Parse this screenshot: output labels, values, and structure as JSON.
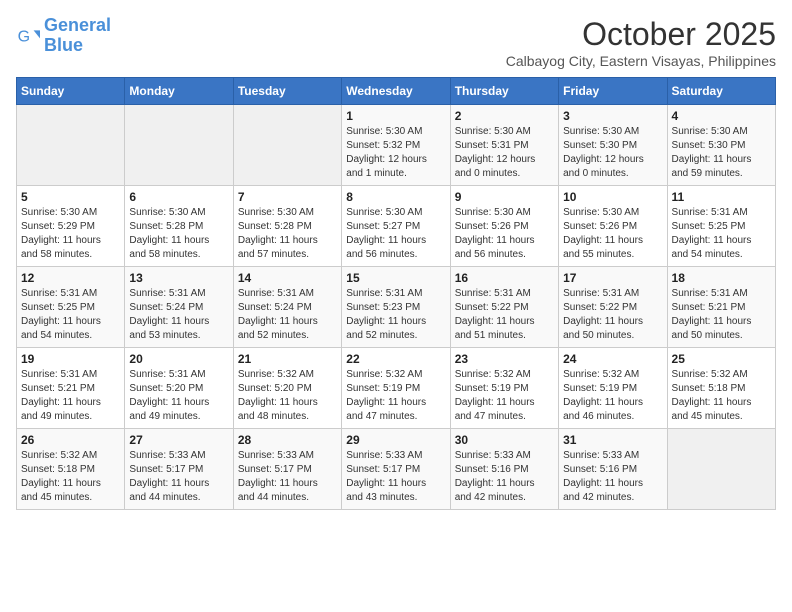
{
  "logo": {
    "line1": "General",
    "line2": "Blue"
  },
  "title": "October 2025",
  "subtitle": "Calbayog City, Eastern Visayas, Philippines",
  "headers": [
    "Sunday",
    "Monday",
    "Tuesday",
    "Wednesday",
    "Thursday",
    "Friday",
    "Saturday"
  ],
  "weeks": [
    [
      {
        "day": "",
        "info": ""
      },
      {
        "day": "",
        "info": ""
      },
      {
        "day": "",
        "info": ""
      },
      {
        "day": "1",
        "info": "Sunrise: 5:30 AM\nSunset: 5:32 PM\nDaylight: 12 hours\nand 1 minute."
      },
      {
        "day": "2",
        "info": "Sunrise: 5:30 AM\nSunset: 5:31 PM\nDaylight: 12 hours\nand 0 minutes."
      },
      {
        "day": "3",
        "info": "Sunrise: 5:30 AM\nSunset: 5:30 PM\nDaylight: 12 hours\nand 0 minutes."
      },
      {
        "day": "4",
        "info": "Sunrise: 5:30 AM\nSunset: 5:30 PM\nDaylight: 11 hours\nand 59 minutes."
      }
    ],
    [
      {
        "day": "5",
        "info": "Sunrise: 5:30 AM\nSunset: 5:29 PM\nDaylight: 11 hours\nand 58 minutes."
      },
      {
        "day": "6",
        "info": "Sunrise: 5:30 AM\nSunset: 5:28 PM\nDaylight: 11 hours\nand 58 minutes."
      },
      {
        "day": "7",
        "info": "Sunrise: 5:30 AM\nSunset: 5:28 PM\nDaylight: 11 hours\nand 57 minutes."
      },
      {
        "day": "8",
        "info": "Sunrise: 5:30 AM\nSunset: 5:27 PM\nDaylight: 11 hours\nand 56 minutes."
      },
      {
        "day": "9",
        "info": "Sunrise: 5:30 AM\nSunset: 5:26 PM\nDaylight: 11 hours\nand 56 minutes."
      },
      {
        "day": "10",
        "info": "Sunrise: 5:30 AM\nSunset: 5:26 PM\nDaylight: 11 hours\nand 55 minutes."
      },
      {
        "day": "11",
        "info": "Sunrise: 5:31 AM\nSunset: 5:25 PM\nDaylight: 11 hours\nand 54 minutes."
      }
    ],
    [
      {
        "day": "12",
        "info": "Sunrise: 5:31 AM\nSunset: 5:25 PM\nDaylight: 11 hours\nand 54 minutes."
      },
      {
        "day": "13",
        "info": "Sunrise: 5:31 AM\nSunset: 5:24 PM\nDaylight: 11 hours\nand 53 minutes."
      },
      {
        "day": "14",
        "info": "Sunrise: 5:31 AM\nSunset: 5:24 PM\nDaylight: 11 hours\nand 52 minutes."
      },
      {
        "day": "15",
        "info": "Sunrise: 5:31 AM\nSunset: 5:23 PM\nDaylight: 11 hours\nand 52 minutes."
      },
      {
        "day": "16",
        "info": "Sunrise: 5:31 AM\nSunset: 5:22 PM\nDaylight: 11 hours\nand 51 minutes."
      },
      {
        "day": "17",
        "info": "Sunrise: 5:31 AM\nSunset: 5:22 PM\nDaylight: 11 hours\nand 50 minutes."
      },
      {
        "day": "18",
        "info": "Sunrise: 5:31 AM\nSunset: 5:21 PM\nDaylight: 11 hours\nand 50 minutes."
      }
    ],
    [
      {
        "day": "19",
        "info": "Sunrise: 5:31 AM\nSunset: 5:21 PM\nDaylight: 11 hours\nand 49 minutes."
      },
      {
        "day": "20",
        "info": "Sunrise: 5:31 AM\nSunset: 5:20 PM\nDaylight: 11 hours\nand 49 minutes."
      },
      {
        "day": "21",
        "info": "Sunrise: 5:32 AM\nSunset: 5:20 PM\nDaylight: 11 hours\nand 48 minutes."
      },
      {
        "day": "22",
        "info": "Sunrise: 5:32 AM\nSunset: 5:19 PM\nDaylight: 11 hours\nand 47 minutes."
      },
      {
        "day": "23",
        "info": "Sunrise: 5:32 AM\nSunset: 5:19 PM\nDaylight: 11 hours\nand 47 minutes."
      },
      {
        "day": "24",
        "info": "Sunrise: 5:32 AM\nSunset: 5:19 PM\nDaylight: 11 hours\nand 46 minutes."
      },
      {
        "day": "25",
        "info": "Sunrise: 5:32 AM\nSunset: 5:18 PM\nDaylight: 11 hours\nand 45 minutes."
      }
    ],
    [
      {
        "day": "26",
        "info": "Sunrise: 5:32 AM\nSunset: 5:18 PM\nDaylight: 11 hours\nand 45 minutes."
      },
      {
        "day": "27",
        "info": "Sunrise: 5:33 AM\nSunset: 5:17 PM\nDaylight: 11 hours\nand 44 minutes."
      },
      {
        "day": "28",
        "info": "Sunrise: 5:33 AM\nSunset: 5:17 PM\nDaylight: 11 hours\nand 44 minutes."
      },
      {
        "day": "29",
        "info": "Sunrise: 5:33 AM\nSunset: 5:17 PM\nDaylight: 11 hours\nand 43 minutes."
      },
      {
        "day": "30",
        "info": "Sunrise: 5:33 AM\nSunset: 5:16 PM\nDaylight: 11 hours\nand 42 minutes."
      },
      {
        "day": "31",
        "info": "Sunrise: 5:33 AM\nSunset: 5:16 PM\nDaylight: 11 hours\nand 42 minutes."
      },
      {
        "day": "",
        "info": ""
      }
    ]
  ]
}
